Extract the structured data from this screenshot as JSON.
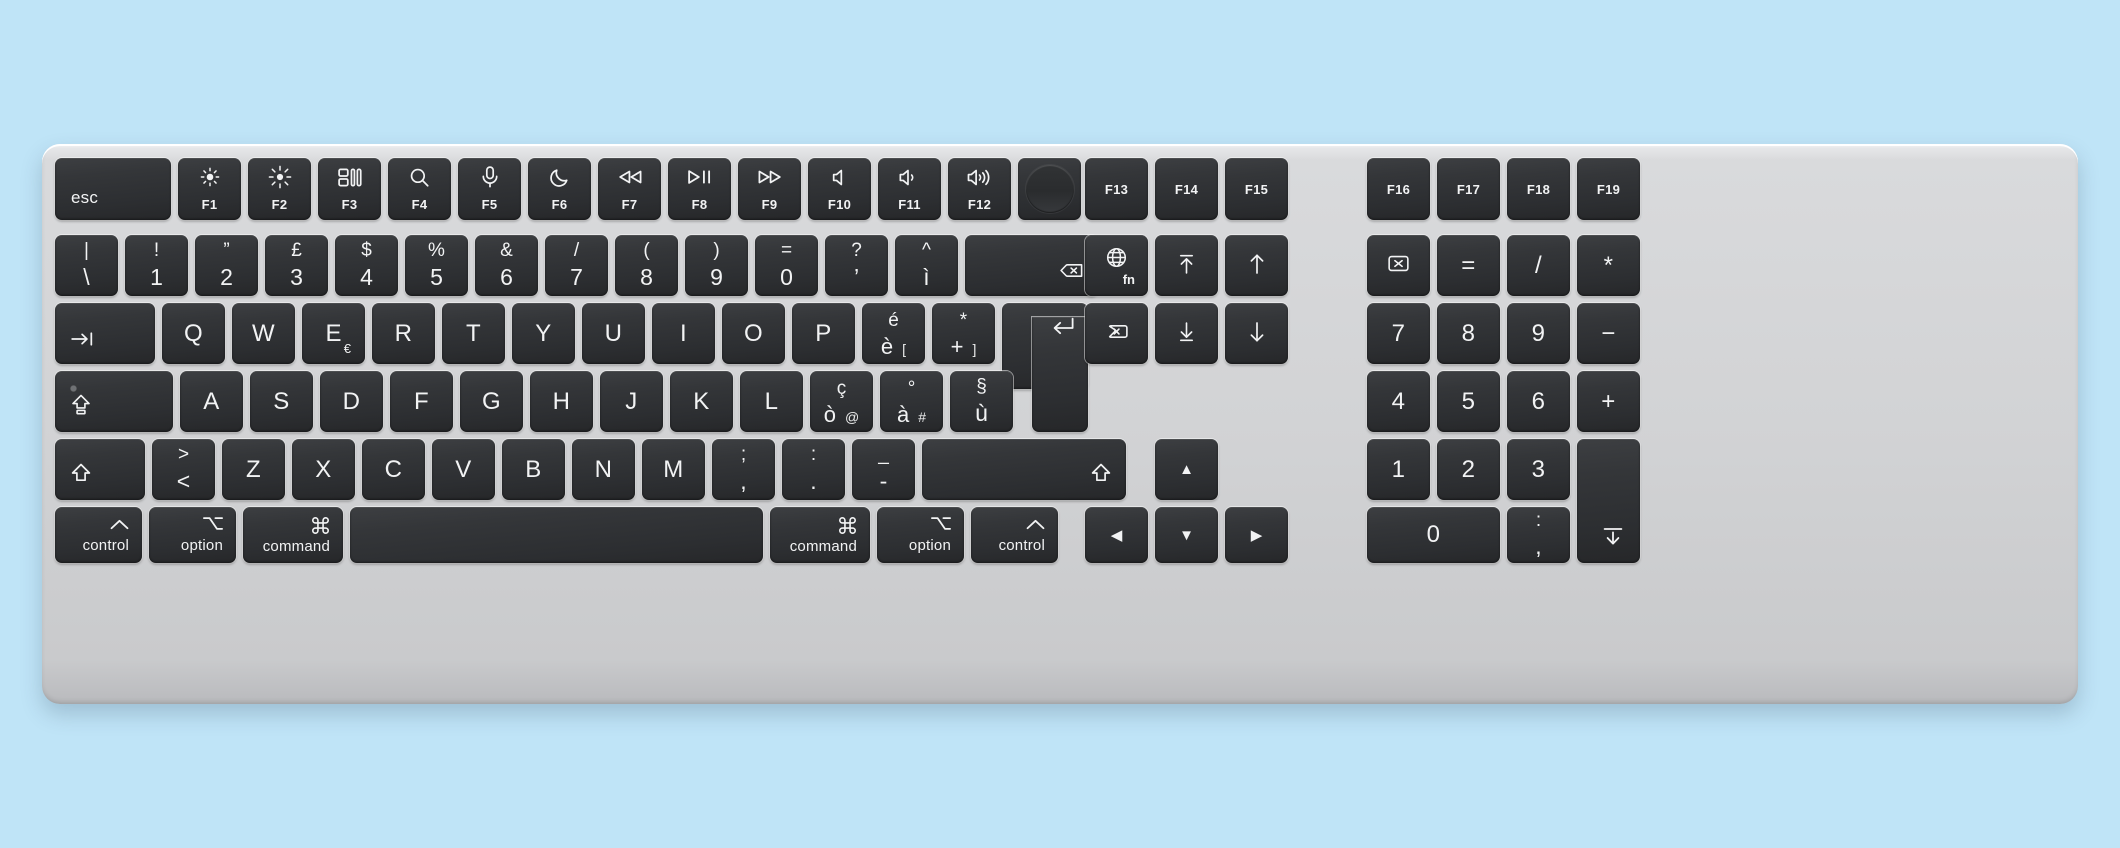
{
  "device": {
    "name": "Apple Magic Keyboard with Touch ID and Numeric Keypad",
    "layout": "Swiss French",
    "body_color": "#d2d3d5",
    "key_color": "#343639",
    "legend_color": "#f2f3f4",
    "background_color": "#bfe4f7"
  },
  "rows": {
    "function_row": [
      {
        "name": "esc-key",
        "label": "esc"
      },
      {
        "name": "f1-key",
        "icon": "brightness-down-icon",
        "glyph": "☀",
        "sub": "F1"
      },
      {
        "name": "f2-key",
        "icon": "brightness-up-icon",
        "glyph": "☼",
        "sub": "F2"
      },
      {
        "name": "f3-key",
        "icon": "mission-control-icon",
        "glyph": "",
        "sub": "F3"
      },
      {
        "name": "f4-key",
        "icon": "spotlight-search-icon",
        "glyph": "⌕",
        "sub": "F4"
      },
      {
        "name": "f5-key",
        "icon": "dictation-mic-icon",
        "glyph": "Ƭ",
        "sub": "F5"
      },
      {
        "name": "f6-key",
        "icon": "do-not-disturb-moon-icon",
        "glyph": "☾",
        "sub": "F6"
      },
      {
        "name": "f7-key",
        "icon": "rewind-icon",
        "glyph": "⏪",
        "sub": "F7"
      },
      {
        "name": "f8-key",
        "icon": "play-pause-icon",
        "glyph": "⏯",
        "sub": "F8"
      },
      {
        "name": "f9-key",
        "icon": "fast-forward-icon",
        "glyph": "⏩",
        "sub": "F9"
      },
      {
        "name": "f10-key",
        "icon": "mute-icon",
        "glyph": "ὐ7",
        "sub": "F10"
      },
      {
        "name": "f11-key",
        "icon": "volume-down-icon",
        "glyph": "",
        "sub": "F11"
      },
      {
        "name": "f12-key",
        "icon": "volume-up-icon",
        "glyph": "",
        "sub": "F12"
      },
      {
        "name": "touch-id-key",
        "icon": "touch-id-icon",
        "glyph": "",
        "sub": ""
      },
      {
        "name": "f13-key",
        "sub": "F13"
      },
      {
        "name": "f14-key",
        "sub": "F14"
      },
      {
        "name": "f15-key",
        "sub": "F15"
      },
      {
        "name": "f16-key",
        "sub": "F16"
      },
      {
        "name": "f17-key",
        "sub": "F17"
      },
      {
        "name": "f18-key",
        "sub": "F18"
      },
      {
        "name": "f19-key",
        "sub": "F19"
      }
    ],
    "number_row": [
      {
        "name": "section-key",
        "top": "|",
        "main": "\\"
      },
      {
        "name": "digit-1-key",
        "top": "!",
        "main": "1"
      },
      {
        "name": "digit-2-key",
        "top": "”",
        "main": "2"
      },
      {
        "name": "digit-3-key",
        "top": "£",
        "main": "3"
      },
      {
        "name": "digit-4-key",
        "top": "$",
        "main": "4"
      },
      {
        "name": "digit-5-key",
        "top": "%",
        "main": "5"
      },
      {
        "name": "digit-6-key",
        "top": "&",
        "main": "6"
      },
      {
        "name": "digit-7-key",
        "top": "/",
        "main": "7"
      },
      {
        "name": "digit-8-key",
        "top": "(",
        "main": "8"
      },
      {
        "name": "digit-9-key",
        "top": ")",
        "main": "9"
      },
      {
        "name": "digit-0-key",
        "top": "=",
        "main": "0"
      },
      {
        "name": "apostrophe-key",
        "top": "?",
        "main": "’"
      },
      {
        "name": "circumflex-key",
        "top": "^",
        "main": "ì"
      },
      {
        "name": "delete-key",
        "glyph": "⌫"
      }
    ],
    "top_letter_row": [
      {
        "name": "tab-key",
        "glyph": "⇥"
      },
      {
        "name": "q-key",
        "main": "Q"
      },
      {
        "name": "w-key",
        "main": "W"
      },
      {
        "name": "e-key",
        "main": "E",
        "alt": "€"
      },
      {
        "name": "r-key",
        "main": "R"
      },
      {
        "name": "t-key",
        "main": "T"
      },
      {
        "name": "y-key",
        "main": "Y"
      },
      {
        "name": "u-key",
        "main": "U"
      },
      {
        "name": "i-key",
        "main": "I"
      },
      {
        "name": "o-key",
        "main": "O"
      },
      {
        "name": "p-key",
        "main": "P"
      },
      {
        "name": "e-acute-key",
        "top": "é",
        "main": "è",
        "alt": "["
      },
      {
        "name": "plus-key",
        "top": "*",
        "main": "+",
        "alt": "]"
      },
      {
        "name": "return-key",
        "glyph": "↩"
      }
    ],
    "home_row": [
      {
        "name": "caps-lock-key",
        "glyph": "⇪"
      },
      {
        "name": "a-key",
        "main": "A"
      },
      {
        "name": "s-key",
        "main": "S"
      },
      {
        "name": "d-key",
        "main": "D"
      },
      {
        "name": "f-key",
        "main": "F"
      },
      {
        "name": "g-key",
        "main": "G"
      },
      {
        "name": "h-key",
        "main": "H"
      },
      {
        "name": "j-key",
        "main": "J"
      },
      {
        "name": "k-key",
        "main": "K"
      },
      {
        "name": "l-key",
        "main": "L"
      },
      {
        "name": "c-cedilla-key",
        "top": "ç",
        "main": "ò",
        "alt": "@"
      },
      {
        "name": "a-grave-key",
        "top": "°",
        "main": "à",
        "alt": "#"
      },
      {
        "name": "section-sign-key",
        "top": "§",
        "main": "ù"
      }
    ],
    "bottom_letter_row": [
      {
        "name": "left-shift-key",
        "glyph": "⇧"
      },
      {
        "name": "angle-bracket-key",
        "top": ">",
        "main": "<"
      },
      {
        "name": "z-key",
        "main": "Z"
      },
      {
        "name": "x-key",
        "main": "X"
      },
      {
        "name": "c-key",
        "main": "C"
      },
      {
        "name": "v-key",
        "main": "V"
      },
      {
        "name": "b-key",
        "main": "B"
      },
      {
        "name": "n-key",
        "main": "N"
      },
      {
        "name": "m-key",
        "main": "M"
      },
      {
        "name": "comma-key",
        "top": ";",
        "main": ","
      },
      {
        "name": "period-key",
        "top": ":",
        "main": "."
      },
      {
        "name": "hyphen-key",
        "top": "_",
        "main": "-"
      },
      {
        "name": "right-shift-key",
        "glyph": "⇧"
      }
    ],
    "modifier_row": [
      {
        "name": "left-control-key",
        "sym": "˄",
        "word": "control"
      },
      {
        "name": "left-option-key",
        "sym": "⌥",
        "word": "option"
      },
      {
        "name": "left-command-key",
        "sym": "⌘",
        "word": "command"
      },
      {
        "name": "space-key",
        "word": ""
      },
      {
        "name": "right-command-key",
        "sym": "⌘",
        "word": "command"
      },
      {
        "name": "right-option-key",
        "sym": "⌥",
        "word": "option"
      },
      {
        "name": "right-control-key",
        "sym": "˄",
        "word": "control"
      }
    ],
    "navigation_cluster": [
      {
        "name": "fn-globe-key",
        "icon": "globe-icon",
        "glyph": "ἱ0",
        "sub": "fn"
      },
      {
        "name": "page-up-key",
        "icon": "page-up-icon",
        "glyph": "↟"
      },
      {
        "name": "home-key",
        "icon": "up-arrow-icon",
        "glyph": "↑"
      },
      {
        "name": "forward-delete-key",
        "icon": "forward-delete-icon",
        "glyph": "⌦"
      },
      {
        "name": "page-down-key",
        "icon": "page-down-icon",
        "glyph": "↡"
      },
      {
        "name": "end-key",
        "icon": "down-arrow-icon",
        "glyph": "↓"
      }
    ],
    "arrow_cluster": [
      {
        "name": "arrow-up-key",
        "glyph": "▲"
      },
      {
        "name": "arrow-left-key",
        "glyph": "◀"
      },
      {
        "name": "arrow-down-key",
        "glyph": "▼"
      },
      {
        "name": "arrow-right-key",
        "glyph": "▶"
      }
    ],
    "numeric_keypad": [
      {
        "name": "numpad-clear-key",
        "glyph": "⌧"
      },
      {
        "name": "numpad-equals-key",
        "main": "="
      },
      {
        "name": "numpad-divide-key",
        "main": "/"
      },
      {
        "name": "numpad-multiply-key",
        "main": "*"
      },
      {
        "name": "numpad-7-key",
        "main": "7"
      },
      {
        "name": "numpad-8-key",
        "main": "8"
      },
      {
        "name": "numpad-9-key",
        "main": "9"
      },
      {
        "name": "numpad-minus-key",
        "main": "−"
      },
      {
        "name": "numpad-4-key",
        "main": "4"
      },
      {
        "name": "numpad-5-key",
        "main": "5"
      },
      {
        "name": "numpad-6-key",
        "main": "6"
      },
      {
        "name": "numpad-plus-key",
        "main": "+"
      },
      {
        "name": "numpad-1-key",
        "main": "1"
      },
      {
        "name": "numpad-2-key",
        "main": "2"
      },
      {
        "name": "numpad-3-key",
        "main": "3"
      },
      {
        "name": "numpad-0-key",
        "main": "0"
      },
      {
        "name": "numpad-decimal-key",
        "top": ":",
        "main": ","
      },
      {
        "name": "numpad-enter-key",
        "glyph": "⌤"
      }
    ]
  }
}
